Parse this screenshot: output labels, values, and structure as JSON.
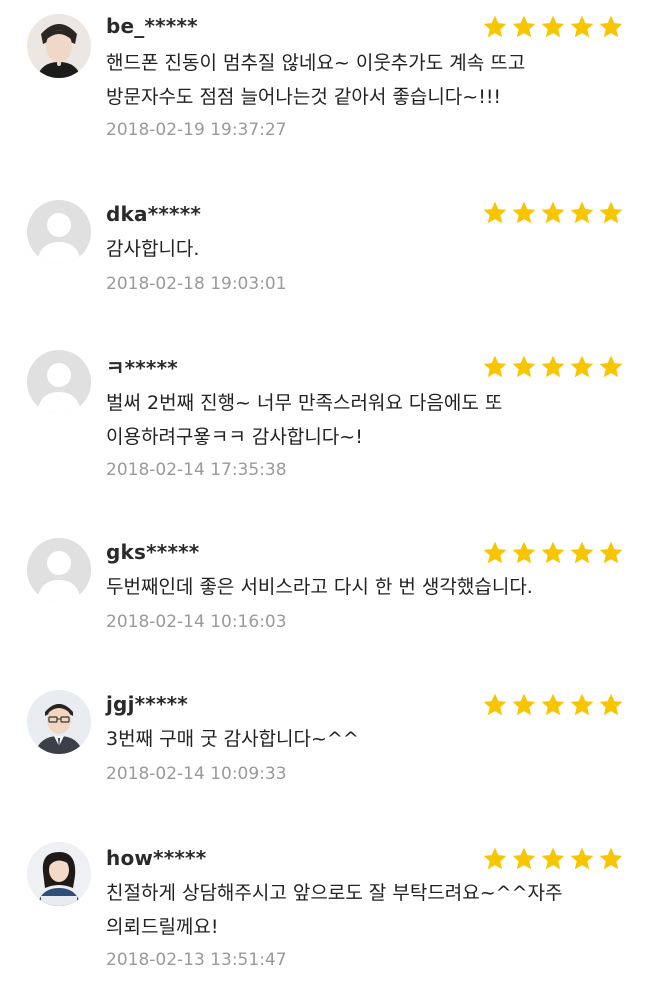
{
  "colors": {
    "star": "#f7c600",
    "username": "#2a2a2a",
    "comment": "#222222",
    "timestamp": "#9a9a9a",
    "avatar_placeholder": "#e0e0e0"
  },
  "rating_icon": "star-icon",
  "reviews": [
    {
      "username": "be_*****",
      "rating": 5,
      "avatar": "user-photo",
      "comment_lines": [
        "핸드폰 진동이 멈추질 않네요~ 이웃추가도 계속 뜨고",
        "방문자수도 점점 늘어나는것 같아서 좋습니다~!!!"
      ],
      "timestamp": "2018-02-19 19:37:27"
    },
    {
      "username": "dka*****",
      "rating": 5,
      "avatar": "default-avatar",
      "comment_lines": [
        "감사합니다."
      ],
      "timestamp": "2018-02-18 19:03:01"
    },
    {
      "username": "ㅋ*****",
      "rating": 5,
      "avatar": "default-avatar",
      "comment_lines": [
        "벌써 2번째 진행~ 너무 만족스러워요 다음에도 또",
        "이용하려구욯ㅋㅋ 감사합니다~!"
      ],
      "timestamp": "2018-02-14 17:35:38"
    },
    {
      "username": "gks*****",
      "rating": 5,
      "avatar": "default-avatar",
      "comment_lines": [
        "두번째인데 좋은 서비스라고 다시 한 번 생각했습니다."
      ],
      "timestamp": "2018-02-14 10:16:03"
    },
    {
      "username": "jgj*****",
      "rating": 5,
      "avatar": "user-photo",
      "comment_lines": [
        "3번째 구매 굿 감사합니다~^^"
      ],
      "timestamp": "2018-02-14 10:09:33"
    },
    {
      "username": "how*****",
      "rating": 5,
      "avatar": "user-photo",
      "comment_lines": [
        "친절하게 상담해주시고 앞으로도 잘 부탁드려요~^^자주",
        "의뢰드릴께요!"
      ],
      "timestamp": "2018-02-13 13:51:47"
    }
  ]
}
